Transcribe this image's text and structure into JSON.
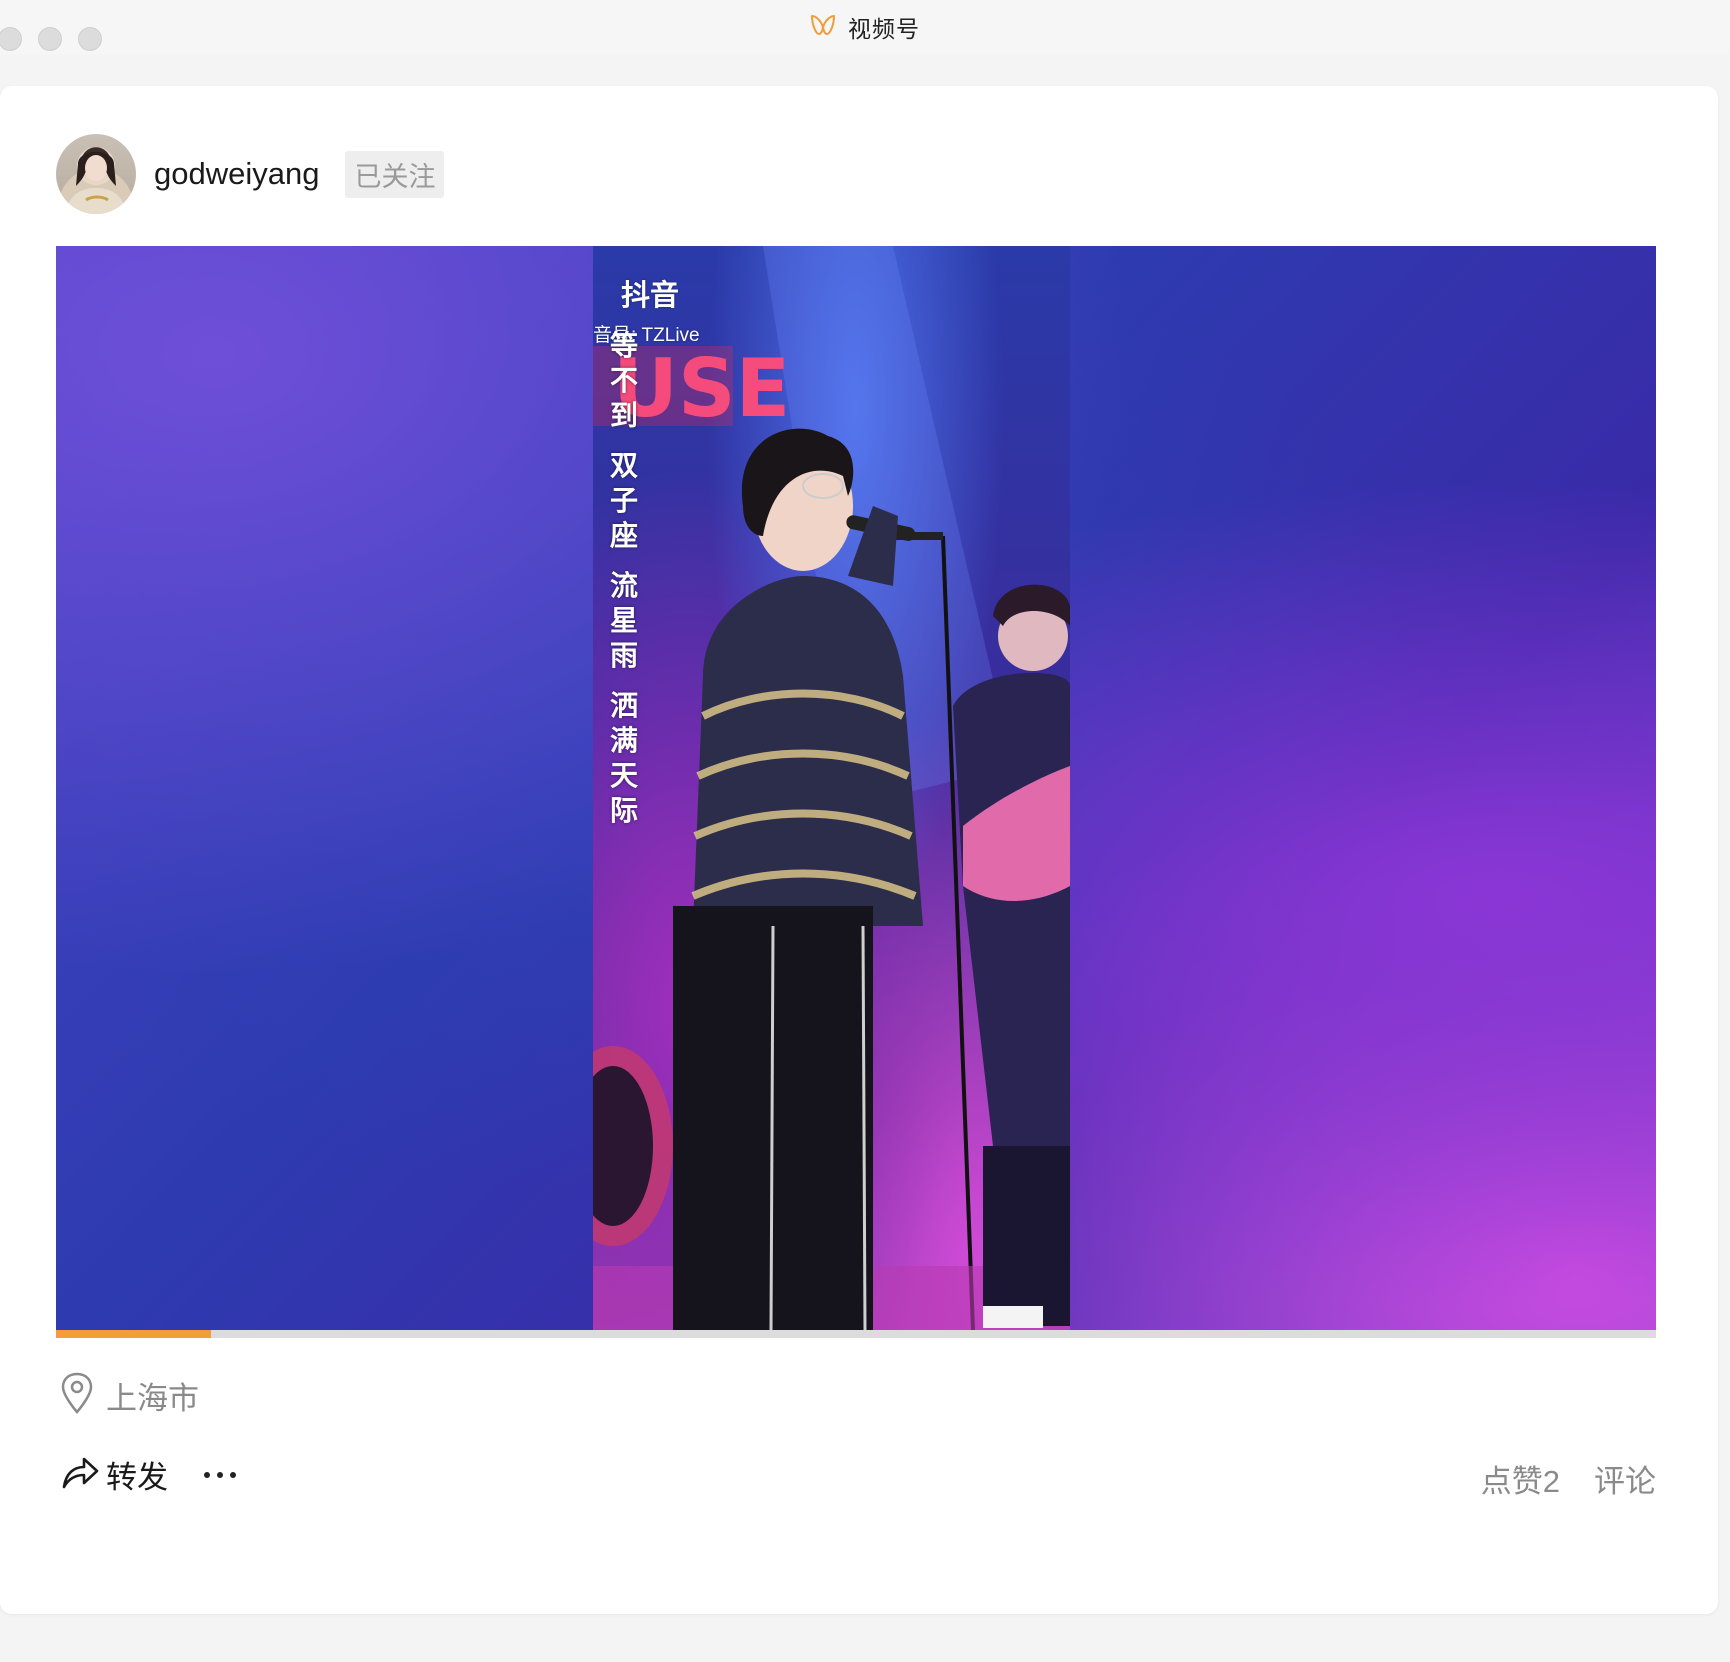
{
  "window": {
    "title": "视频号",
    "logo_icon": "channels-butterfly-icon",
    "accent_color": "#f29d38"
  },
  "post": {
    "author": {
      "name": "godweiyang",
      "follow_status": "已关注"
    },
    "video": {
      "watermark_logo": "抖音",
      "watermark_id": "音号: TZLive",
      "lyrics_vertical": [
        "等不到",
        "双子座",
        "流星雨",
        "洒满天际"
      ],
      "progress": 0.097
    },
    "location": {
      "icon": "location-pin-icon",
      "text": "上海市"
    },
    "actions": {
      "share_label": "转发",
      "like_label": "点赞2",
      "comment_label": "评论"
    }
  }
}
